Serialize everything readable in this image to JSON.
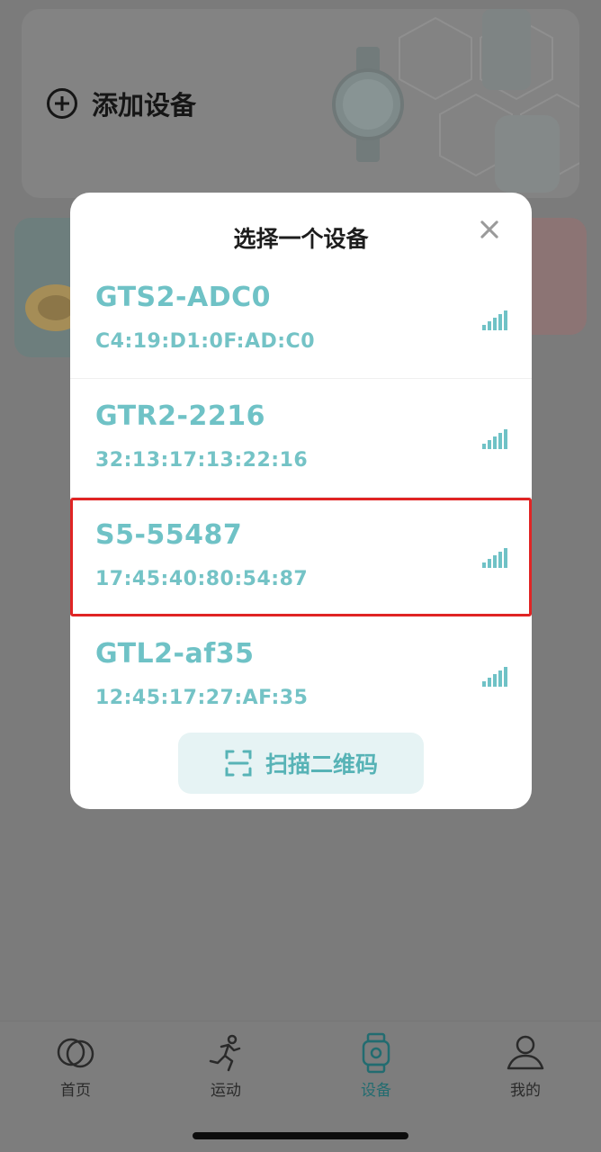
{
  "background": {
    "add_device_label": "添加设备"
  },
  "modal": {
    "title": "选择一个设备",
    "devices": [
      {
        "name": "GTS2-ADC0",
        "mac": "C4:19:D1:0F:AD:C0",
        "selected": false
      },
      {
        "name": "GTR2-2216",
        "mac": "32:13:17:13:22:16",
        "selected": false
      },
      {
        "name": "S5-55487",
        "mac": "17:45:40:80:54:87",
        "selected": true
      },
      {
        "name": "GTL2-af35",
        "mac": "12:45:17:27:AF:35",
        "selected": false
      }
    ],
    "scan_label": "扫描二维码"
  },
  "tabbar": {
    "tabs": [
      {
        "label": "首页",
        "icon": "home-circles-icon",
        "active": false
      },
      {
        "label": "运动",
        "icon": "running-icon",
        "active": false
      },
      {
        "label": "设备",
        "icon": "watch-icon",
        "active": true
      },
      {
        "label": "我的",
        "icon": "profile-icon",
        "active": false
      }
    ]
  },
  "colors": {
    "accent": "#6fc2c6",
    "highlight_border": "#e02424",
    "scan_bg": "#e6f3f4"
  }
}
